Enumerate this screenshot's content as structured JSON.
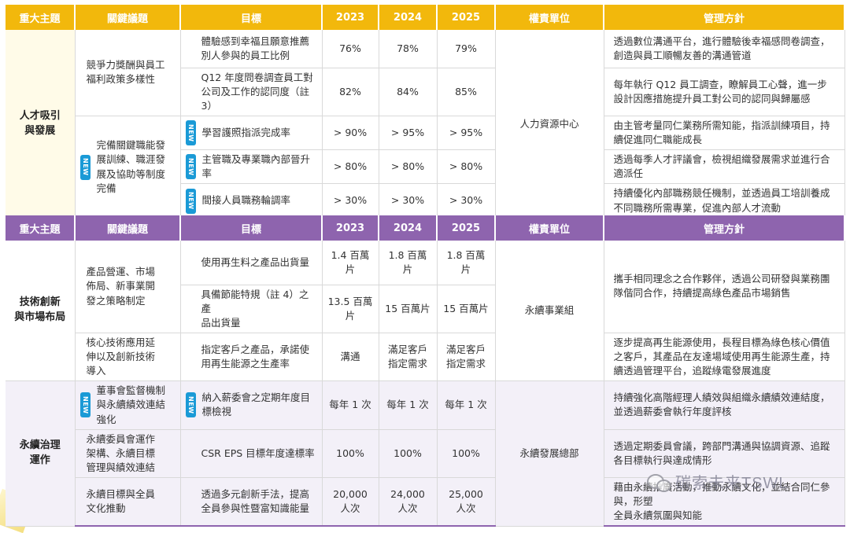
{
  "headers": {
    "theme": "重大主題",
    "issue": "關鍵議題",
    "target": "目標",
    "y2023": "2023",
    "y2024": "2024",
    "y2025": "2025",
    "dept": "權責單位",
    "policy": "管理方針"
  },
  "new_badge": "NEW",
  "table1": {
    "theme": "人才吸引\n與發展",
    "dept": "人力資源中心",
    "issue1": "競爭力獎酬與員工\n福利政策多樣性",
    "issue2": "完備關鍵職能發\n展訓練、職涯發\n展及協助等制度\n完備",
    "rows": [
      {
        "target": "體驗感到幸福且願意推薦\n別人參與的員工比例",
        "y2023": "76%",
        "y2024": "78%",
        "y2025": "79%",
        "policy": "透過數位溝通平台，進行體驗後幸福感問卷調查，\n創造與員工順暢友善的溝通管道"
      },
      {
        "target": "Q12 年度問卷調查員工對\n公司及工作的認同度（註 3）",
        "y2023": "82%",
        "y2024": "84%",
        "y2025": "85%",
        "policy": "每年執行 Q12 員工調查，瞭解員工心聲，進一步\n設計因應措施提升員工對公司的認同與歸屬感"
      },
      {
        "target": "學習護照指派完成率",
        "y2023": "> 90%",
        "y2024": "> 95%",
        "y2025": "> 95%",
        "policy": "由主管考量同仁業務所需知能，指派訓練項目，持\n續促進同仁職能成長"
      },
      {
        "target": "主管職及專業職內部晉升率",
        "y2023": "> 80%",
        "y2024": "> 80%",
        "y2025": "> 80%",
        "policy": "透過每季人才評議會，檢視組織發展需求並進行合\n適派任"
      },
      {
        "target": "間接人員職務輪調率",
        "y2023": "> 30%",
        "y2024": "> 30%",
        "y2025": "> 30%",
        "policy": "持續優化內部職務競任機制，並透過員工培訓養成\n不同職務所需專業，促進內部人才流動"
      }
    ]
  },
  "table2": {
    "theme1": "技術創新\n與市場布局",
    "theme2": "永續治理\n運作",
    "dept1": "永續事業組",
    "dept2": "永續發展總部",
    "issue1": "產品營運、市場\n佈局、新事業開\n發之策略制定",
    "policy1": "攜手相同理念之合作夥伴，透過公司研發與業務團\n隊偕同合作，持續提高綠色產品市場銷售",
    "rows": [
      {
        "target": "使用再生料之產品出貨量",
        "y2023": "1.4 百萬片",
        "y2024": "1.8 百萬片",
        "y2025": "1.8 百萬片"
      },
      {
        "target": "具備節能特規（註 4）之產\n品出貨量",
        "y2023": "13.5 百萬片",
        "y2024": "15 百萬片",
        "y2025": "15 百萬片"
      },
      {
        "issue": "核心技術應用延\n伸以及創新技術\n導入",
        "target": "指定客戶之產品，承諾使\n用再生能源之生產率",
        "y2023": "溝通",
        "y2024": "滿足客戶\n指定需求",
        "y2025": "滿足客戶\n指定需求",
        "policy": "逐步提高再生能源使用，長程目標為綠色核心價值\n之客戶，其產品在友達場域使用再生能源生產，持\n續透過管理平台，追蹤綠電發展進度"
      },
      {
        "issue": "董事會監督機制\n與永續績效連結\n強化",
        "target": "納入薪委會之定期年度目\n標檢視",
        "y2023": "每年 1 次",
        "y2024": "每年 1 次",
        "y2025": "每年 1 次",
        "policy": "持續強化高階經理人績效與組織永續績效連結度，\n並透過薪委會執行年度評核"
      },
      {
        "issue": "永續委員會運作\n架構、永續目標\n管理與績效連結",
        "target": "CSR EPS 目標年度達標率",
        "y2023": "100%",
        "y2024": "100%",
        "y2025": "100%",
        "policy": "透過定期委員會議，跨部門溝通與協調資源、追蹤\n各目標執行與達成情形"
      },
      {
        "issue": "永續目標與全員\n文化推動",
        "target": "透過多元創新手法，提高\n全員參與性暨富知識能量",
        "y2023": "20,000\n人次",
        "y2024": "24,000\n人次",
        "y2025": "25,000\n人次",
        "policy": "藉由永續推廣活動，推動永續文化，並結合同仁參與，形塑\n全員永續氛圍與知能"
      }
    ]
  },
  "watermark": "碳索未来TSWL",
  "watermark_icon": "wechat-icon"
}
